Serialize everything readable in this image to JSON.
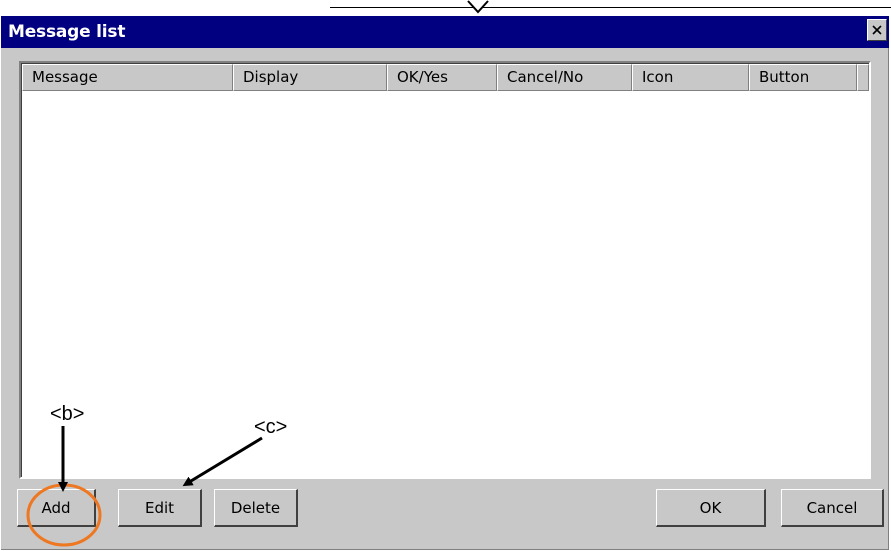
{
  "window": {
    "title": "Message list",
    "close_glyph": "✕",
    "title_bar_color": "#000080",
    "face_color": "#c8c8c8"
  },
  "list": {
    "columns": [
      "Message",
      "Display",
      "OK/Yes",
      "Cancel/No",
      "Icon",
      "Button"
    ],
    "rows": []
  },
  "buttons": {
    "add": "Add",
    "edit": "Edit",
    "delete": "Delete",
    "ok": "OK",
    "cancel": "Cancel"
  },
  "annotations": {
    "b": "<b>",
    "c": "<c>",
    "highlight_color": "#ee7722"
  },
  "icons": {
    "close": "close-icon",
    "top_marker": "chevron-down-icon"
  }
}
